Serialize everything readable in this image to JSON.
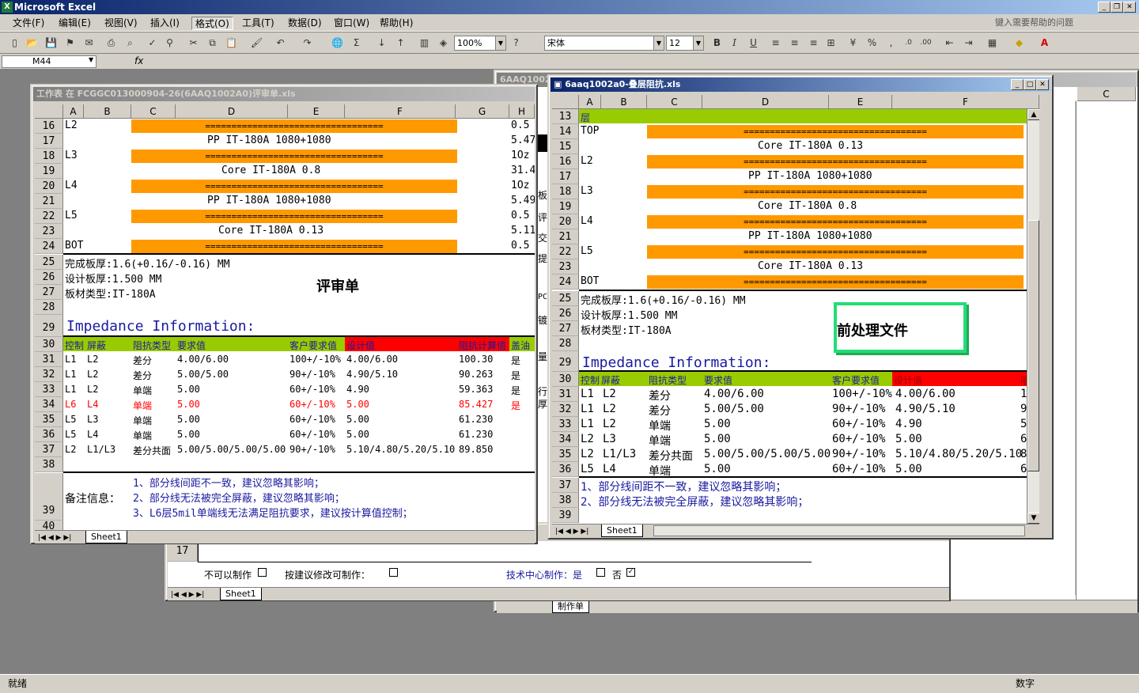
{
  "app": {
    "title": "Microsoft Excel",
    "help_placeholder": "键入需要帮助的问题"
  },
  "menu": [
    "文件(F)",
    "编辑(E)",
    "视图(V)",
    "插入(I)",
    "格式(O)",
    "工具(T)",
    "数据(D)",
    "窗口(W)",
    "帮助(H)"
  ],
  "toolbar": {
    "zoom": "100%",
    "font": "宋体",
    "size": "12"
  },
  "formula": {
    "namebox": "M44",
    "fx": "fx"
  },
  "status": {
    "left": "就绪",
    "right": "数字"
  },
  "bg_window": {
    "title": "6AAQ1002",
    "tab": "制作单"
  },
  "review_bottom": {
    "row17": "17",
    "row17b": "17",
    "cannot": "不可以制作",
    "suggest": "按建议修改可制作：",
    "tech": "技术中心制作：是",
    "no": "否",
    "tab": "Sheet1"
  },
  "win1": {
    "title": "工作表 在 FCGGC013000904-26(6AAQ1002A0)评审单.xls",
    "cols": [
      "A",
      "B",
      "C",
      "D",
      "E",
      "F",
      "G",
      "H"
    ],
    "stack": [
      {
        "row": "16",
        "a": "L2",
        "bar": "==================================",
        "h": "0.5"
      },
      {
        "row": "17",
        "d": "PP      IT-180A     1080+1080",
        "h": "5.47"
      },
      {
        "row": "18",
        "a": "L3",
        "bar": "==================================",
        "h": "1Oz"
      },
      {
        "row": "19",
        "d": "Core      IT-180A     0.8",
        "h": "31.4"
      },
      {
        "row": "20",
        "a": "L4",
        "bar": "==================================",
        "h": "1Oz"
      },
      {
        "row": "21",
        "d": "PP      IT-180A     1080+1080",
        "h": "5.49"
      },
      {
        "row": "22",
        "a": "L5",
        "bar": "==================================",
        "h": "0.5"
      },
      {
        "row": "23",
        "d": "Core      IT-180A     0.13",
        "h": "5.11"
      },
      {
        "row": "24",
        "a": "BOT",
        "bar": "==================================",
        "h": "0.5"
      }
    ],
    "info": [
      "完成板厚:1.6(+0.16/-0.16) MM",
      "设计板厚:1.500 MM",
      "板材类型:IT-180A"
    ],
    "info_rows": [
      "25",
      "26",
      "27",
      "28",
      "29"
    ],
    "review_label": "评审单",
    "imp_title": "Impedance Information:",
    "imp_header": {
      "row": "30",
      "ctrl": "控制",
      "shield": "屏蔽",
      "type": "阻抗类型",
      "req": "要求值",
      "cust": "客户要求值",
      "design": "设计值",
      "calc": "阻抗计算值",
      "ink": "盖油"
    },
    "imp_rows": [
      {
        "row": "31",
        "a": "L1",
        "b": "L2",
        "type": "差分",
        "req": "4.00/6.00",
        "cust": "100+/-10%",
        "design": "4.00/6.00",
        "calc": "100.30",
        "ink": "是"
      },
      {
        "row": "32",
        "a": "L1",
        "b": "L2",
        "type": "差分",
        "req": "5.00/5.00",
        "cust": "90+/-10%",
        "design": "4.90/5.10",
        "calc": "90.263",
        "ink": "是"
      },
      {
        "row": "33",
        "a": "L1",
        "b": "L2",
        "type": "单端",
        "req": "5.00",
        "cust": "60+/-10%",
        "design": "4.90",
        "calc": "59.363",
        "ink": "是"
      },
      {
        "row": "34",
        "a": "L6",
        "b": "L4",
        "type": "单端",
        "req": "5.00",
        "cust": "60+/-10%",
        "design": "5.00",
        "calc": "85.427",
        "ink": "是"
      },
      {
        "row": "35",
        "a": "L5",
        "b": "L3",
        "type": "单端",
        "req": "5.00",
        "cust": "60+/-10%",
        "design": "5.00",
        "calc": "61.230",
        "ink": ""
      },
      {
        "row": "36",
        "a": "L5",
        "b": "L4",
        "type": "单端",
        "req": "5.00",
        "cust": "60+/-10%",
        "design": "5.00",
        "calc": "61.230",
        "ink": ""
      },
      {
        "row": "37",
        "a": "L2",
        "b": "L1/L3",
        "type": "差分共面",
        "req": "5.00/5.00/5.00/5.00",
        "cust": "90+/-10%",
        "design": "5.10/4.80/5.20/5.10",
        "calc": "89.850",
        "ink": ""
      }
    ],
    "row38": "38",
    "row39": "39",
    "row40": "40",
    "remark_label": "备注信息：",
    "remarks": [
      "1、部分线间距不一致，建议忽略其影响；",
      "2、部分线无法被完全屏蔽，建议忽略其影响；",
      "3、L6层5mil单端线无法满足阻抗要求，建议按计算值控制；"
    ],
    "tab": "Sheet1"
  },
  "win2": {
    "title": "6aaq1002a0-叠层阻抗.xls",
    "cols": [
      "A",
      "B",
      "C",
      "D",
      "E",
      "F"
    ],
    "row13": {
      "row": "13",
      "a": "层"
    },
    "stack": [
      {
        "row": "14",
        "a": "TOP",
        "bar": "==================================="
      },
      {
        "row": "15",
        "d": "Core      IT-180A     0.13"
      },
      {
        "row": "16",
        "a": "L2",
        "bar": "==================================="
      },
      {
        "row": "17",
        "d": "PP      IT-180A     1080+1080"
      },
      {
        "row": "18",
        "a": "L3",
        "bar": "==================================="
      },
      {
        "row": "19",
        "d": "Core      IT-180A     0.8"
      },
      {
        "row": "20",
        "a": "L4",
        "bar": "==================================="
      },
      {
        "row": "21",
        "d": "PP      IT-180A     1080+1080"
      },
      {
        "row": "22",
        "a": "L5",
        "bar": "==================================="
      },
      {
        "row": "23",
        "d": "Core      IT-180A     0.13"
      },
      {
        "row": "24",
        "a": "BOT",
        "bar": "==================================="
      }
    ],
    "info": [
      "完成板厚:1.6(+0.16/-0.16) MM",
      "设计板厚:1.500 MM",
      "板材类型:IT-180A"
    ],
    "info_rows": [
      "25",
      "26",
      "27",
      "28",
      "29"
    ],
    "pre_label": "前处理文件",
    "imp_title": "Impedance Information:",
    "imp_header": {
      "row": "30",
      "ctrl": "控制",
      "shield": "屏蔽",
      "type": "阻抗类型",
      "req": "要求值",
      "cust": "客户要求值",
      "design": "设计值",
      "calc": "阻抗"
    },
    "imp_rows": [
      {
        "row": "31",
        "a": "L1",
        "b": "L2",
        "type": "差分",
        "req": "4.00/6.00",
        "cust": "100+/-10%",
        "design": "4.00/6.00",
        "calc": "100"
      },
      {
        "row": "32",
        "a": "L1",
        "b": "L2",
        "type": "差分",
        "req": "5.00/5.00",
        "cust": "90+/-10%",
        "design": "4.90/5.10",
        "calc": "90."
      },
      {
        "row": "33",
        "a": "L1",
        "b": "L2",
        "type": "单端",
        "req": "5.00",
        "cust": "60+/-10%",
        "design": "4.90",
        "calc": "59."
      },
      {
        "row": "34",
        "a": "L2",
        "b": "L3",
        "type": "单端",
        "req": "5.00",
        "cust": "60+/-10%",
        "design": "5.00",
        "calc": "61."
      },
      {
        "row": "35",
        "a": "L2",
        "b": "L1/L3",
        "type": "差分共面",
        "req": "5.00/5.00/5.00/5.00",
        "cust": "90+/-10%",
        "design": "5.10/4.80/5.20/5.10",
        "calc": "88."
      },
      {
        "row": "36",
        "a": "L5",
        "b": "L4",
        "type": "单端",
        "req": "5.00",
        "cust": "60+/-10%",
        "design": "5.00",
        "calc": "61."
      }
    ],
    "remark_rows": [
      {
        "row": "37",
        "text": "1、部分线间距不一致，建议忽略其影响；"
      },
      {
        "row": "38",
        "text": "2、部分线无法被完全屏蔽，建议忽略其影响；"
      },
      {
        "row": "39",
        "text": ""
      }
    ],
    "tab": "Sheet1"
  },
  "right_sheet": {
    "col": "C"
  },
  "side_chars": [
    "板",
    "评",
    "交",
    "提",
    "PC",
    "镀",
    "量",
    "行",
    "厚"
  ]
}
